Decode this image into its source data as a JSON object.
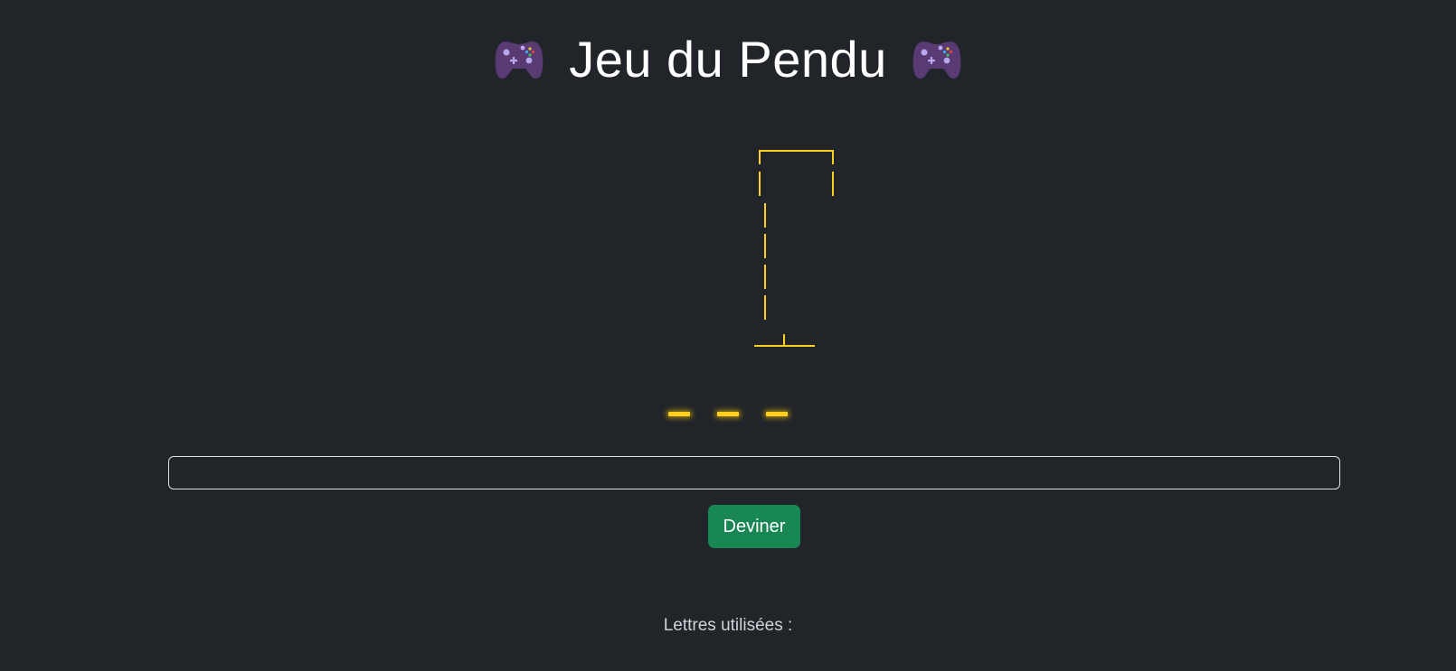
{
  "header": {
    "title": "Jeu du Pendu",
    "left_icon": "gamepad-icon",
    "right_icon": "gamepad-icon"
  },
  "game": {
    "word_length": 3,
    "hidden_letters": [
      "",
      "",
      ""
    ],
    "accent_color": "#ffcf1f",
    "gallows_icon": "gallows-drawing"
  },
  "input": {
    "value": "",
    "placeholder": ""
  },
  "guess_button": {
    "label": "Deviner",
    "color": "#198754"
  },
  "used_letters": {
    "label": "Lettres utilisées :",
    "letters": ""
  },
  "colors": {
    "background": "#212529",
    "text": "#ffffff"
  }
}
